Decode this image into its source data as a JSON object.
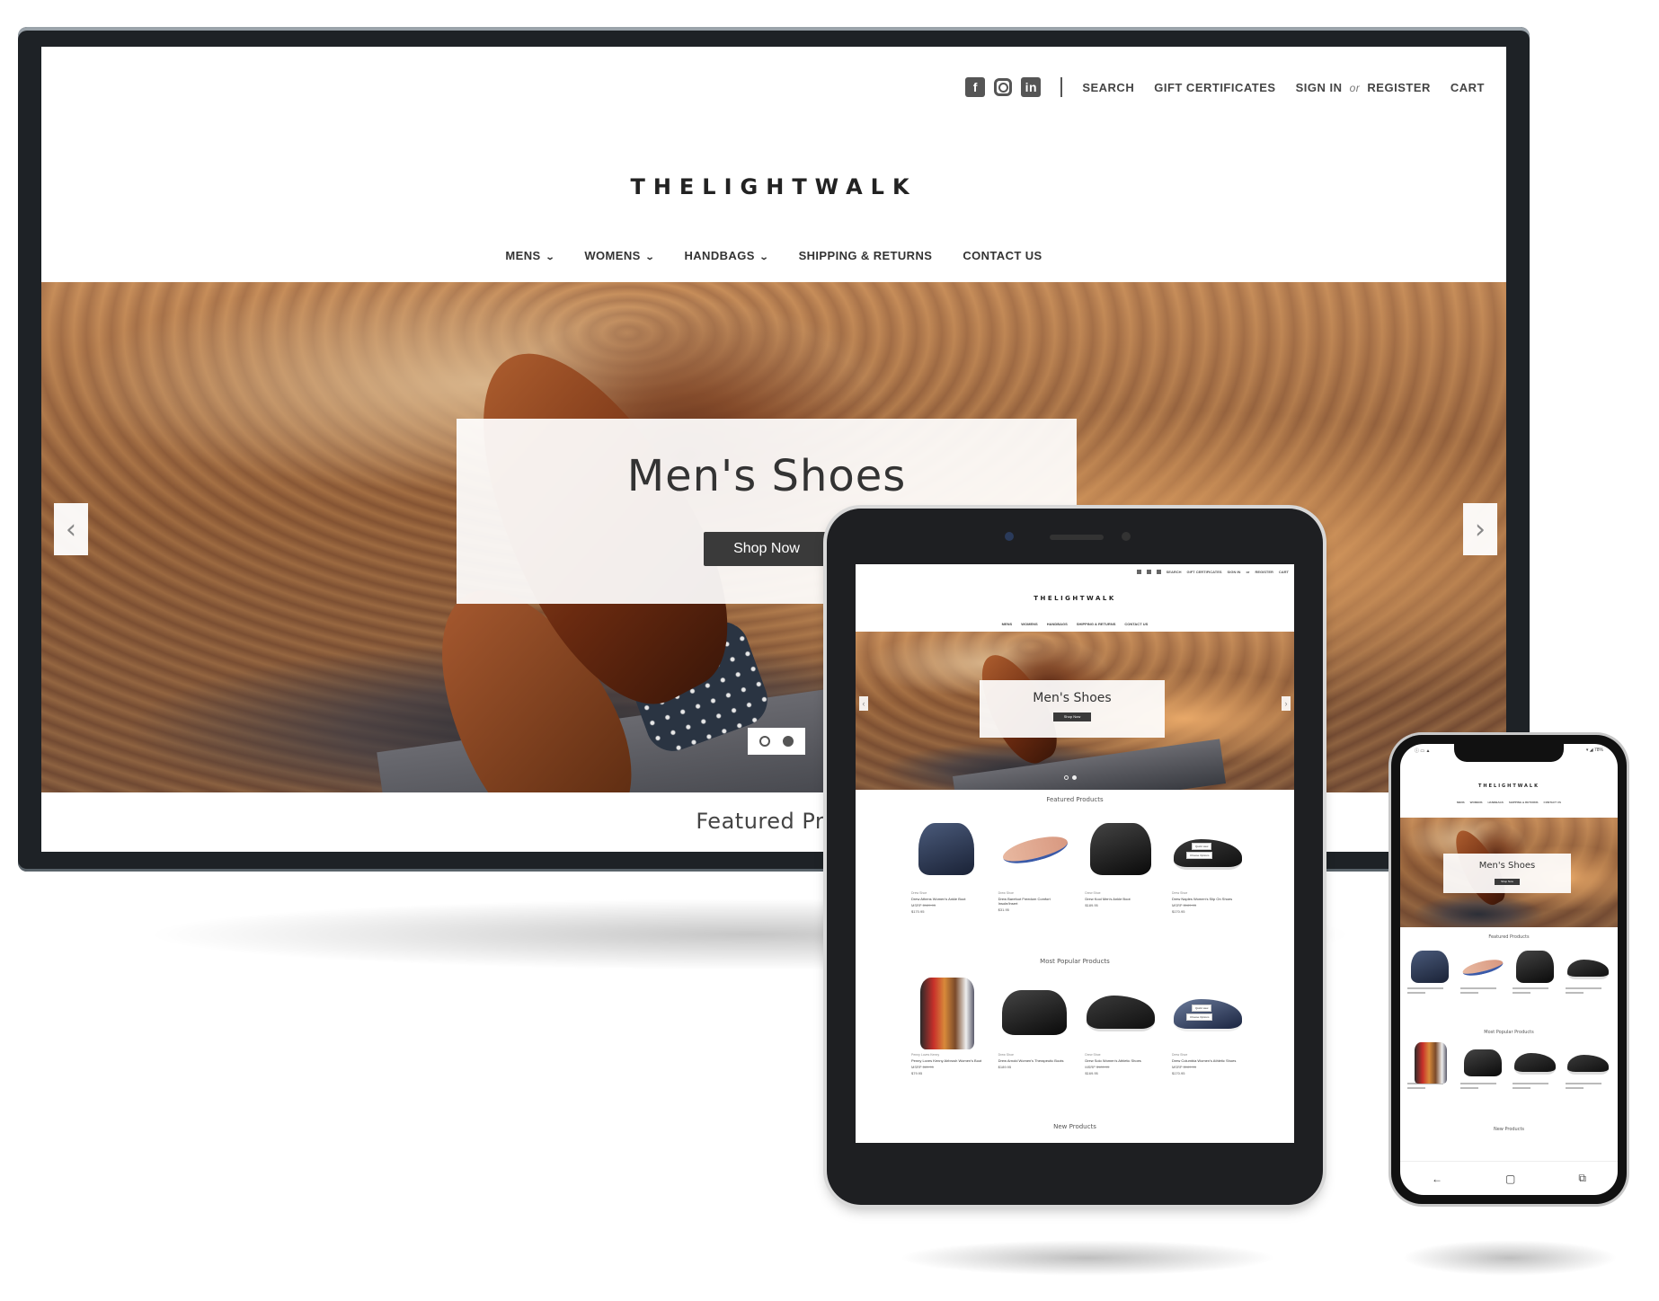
{
  "site": {
    "logo": "THELIGHTWALK",
    "topbar": {
      "social": [
        "facebook-icon",
        "instagram-icon",
        "linkedin-icon"
      ],
      "search": "SEARCH",
      "gift": "GIFT CERTIFICATES",
      "sign_in": "SIGN IN",
      "or": "or",
      "register": "REGISTER",
      "cart": "CART"
    },
    "nav": [
      {
        "label": "MENS",
        "dropdown": true
      },
      {
        "label": "WOMENS",
        "dropdown": true
      },
      {
        "label": "HANDBAGS",
        "dropdown": true
      },
      {
        "label": "SHIPPING & RETURNS",
        "dropdown": false
      },
      {
        "label": "CONTACT US",
        "dropdown": false
      }
    ],
    "hero": {
      "title": "Men's Shoes",
      "cta": "Shop Now",
      "prev_icon": "chevron-left-icon",
      "next_icon": "chevron-right-icon",
      "slides": 2,
      "active_slide": 2
    },
    "sections": {
      "featured": "Featured Products",
      "popular": "Most Popular Products",
      "new": "New Products"
    }
  },
  "monitor": {
    "featured_partial": "Featured Prod"
  },
  "tablet": {
    "nav_short": [
      "MENS",
      "WOMENS",
      "HANDBAGS",
      "SHIPPING & RETURNS",
      "CONTACT US"
    ],
    "featured_products": [
      {
        "brand": "Drew Shoe",
        "name": "Drew Athens Women's Ankle Boot",
        "msrp": "$189.95",
        "price": "$170.95",
        "kind": "boot-blue"
      },
      {
        "brand": "Drew Shoe",
        "name": "Drew Barefoot Freedom Comfort Insole/Insert",
        "price": "$31.95",
        "kind": "insole"
      },
      {
        "brand": "Drew Shoe",
        "name": "Drew Kool Men's Ankle Boot",
        "price": "$189.95",
        "kind": "boot-black"
      },
      {
        "brand": "Drew Shoe",
        "name": "Drew Naples Women's Slip On Shoes",
        "msrp": "$189.95",
        "price": "$170.95",
        "kind": "sneaker-dark",
        "quick_view": "Quick view",
        "choose": "Choose Options"
      }
    ],
    "popular_products": [
      {
        "brand": "Penny Loves Kenny",
        "name": "Penny Loves Kenny Airbrush Women's Boot",
        "msrp": "$89.95",
        "price": "$79.95",
        "kind": "fur-boot"
      },
      {
        "brand": "Drew Shoe",
        "name": "Drew Arnold Women's Therapeutic Boots",
        "price": "$189.95",
        "kind": "boot-black"
      },
      {
        "brand": "Drew Shoe",
        "name": "Drew Solo Women's Athletic Shoes",
        "msrp": "$189.95",
        "price": "$169.95",
        "kind": "sneaker-dark"
      },
      {
        "brand": "Drew Shoe",
        "name": "Drew Columbia Women's Athletic Shoes",
        "msrp": "$189.95",
        "price": "$170.95",
        "kind": "sneaker-navy",
        "quick_view": "Quick view",
        "choose": "Choose Options"
      }
    ]
  },
  "phone": {
    "status_left": "ⓘ ▭ ▲",
    "status_right": "▾ ◢ 78%",
    "navbar": {
      "back": "←",
      "home": "▢",
      "recent": "⧉"
    }
  }
}
